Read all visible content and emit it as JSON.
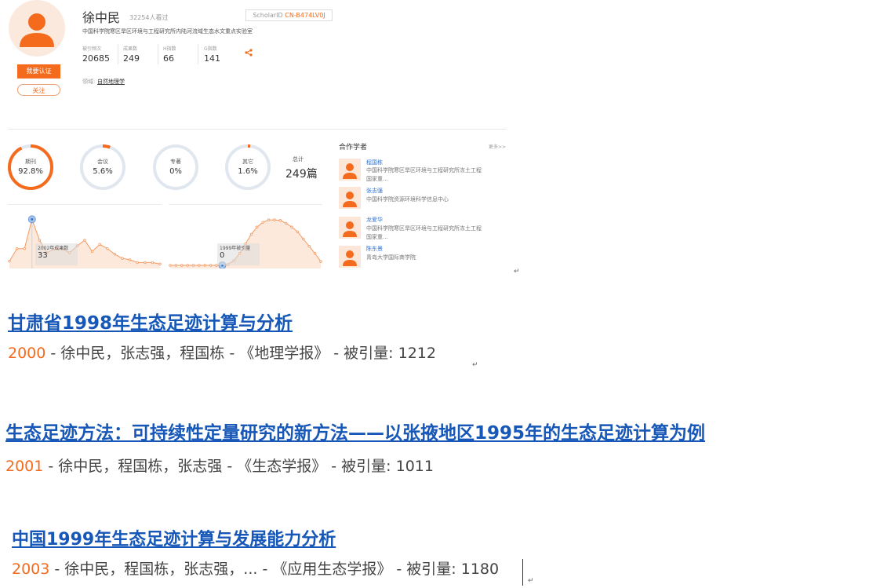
{
  "profile": {
    "name": "徐中民",
    "views": "32254人看过",
    "scholar_id_label": "ScholarID ",
    "scholar_id": "CN-B474LV0J",
    "affiliation": "中国科学院寒区旱区环境与工程研究所内陆河流域生态水文重点实验室",
    "verify_button": "我要认证",
    "follow_button": "关注",
    "stats": [
      {
        "label": "被引频次",
        "value": "20685"
      },
      {
        "label": "成果数",
        "value": "249"
      },
      {
        "label": "H指数",
        "value": "66"
      },
      {
        "label": "G指数",
        "value": "141"
      }
    ],
    "field_label": "领域:",
    "field_value": "自然地理学"
  },
  "pub_types": [
    {
      "label": "期刊",
      "value": "92.8%",
      "fraction": 0.928
    },
    {
      "label": "会议",
      "value": "5.6%",
      "fraction": 0.056
    },
    {
      "label": "专著",
      "value": "0%",
      "fraction": 0
    },
    {
      "label": "其它",
      "value": "1.6%",
      "fraction": 0.016
    }
  ],
  "total": {
    "label": "总计",
    "value": "249篇"
  },
  "coauthors": {
    "title": "合作学者",
    "more": "更多>>",
    "items": [
      {
        "name": "程国栋",
        "affiliation": "中国科学院寒区旱区环境与工程研究所冻土工程国家重..."
      },
      {
        "name": "张志强",
        "affiliation": "中国科学院资源环境科学信息中心"
      },
      {
        "name": "龙爱华",
        "affiliation": "中国科学院寒区旱区环境与工程研究所冻土工程国家重..."
      },
      {
        "name": "陈东景",
        "affiliation": "青岛大学国际商学院"
      }
    ]
  },
  "chart_data": [
    {
      "type": "area",
      "title": "",
      "tooltip_label": "2002年成果数",
      "tooltip_value": "33",
      "values": [
        3,
        12,
        12,
        33,
        18,
        9,
        12,
        12,
        9,
        14,
        18,
        10,
        15,
        12,
        8,
        5,
        4,
        2,
        2,
        2,
        1
      ],
      "highlight_index": 3,
      "ylim": [
        0,
        36
      ]
    },
    {
      "type": "area",
      "title": "",
      "tooltip_label": "1999年被引量",
      "tooltip_value": "0",
      "values": [
        0,
        0,
        0,
        0,
        0,
        0,
        0,
        0,
        0,
        0,
        2,
        10,
        25,
        45,
        65,
        80,
        90,
        95,
        95,
        94,
        88,
        80,
        70,
        55,
        40,
        25,
        8
      ],
      "highlight_index": 9,
      "ylim": [
        0,
        105
      ]
    }
  ],
  "papers": [
    {
      "title": "甘肃省1998年生态足迹计算与分析",
      "year": "2000",
      "authors": " - 徐中民，张志强，程国栋 - ",
      "journal": "《地理学报》",
      "cited": " - 被引量: 1212"
    },
    {
      "title": "生态足迹方法：可持续性定量研究的新方法——以张掖地区1995年的生态足迹计算为例",
      "year": "2001",
      "authors": " - 徐中民，程国栋，张志强 - ",
      "journal": "《生态学报》",
      "cited": " - 被引量: 1011"
    },
    {
      "title": "中国1999年生态足迹计算与发展能力分析",
      "year": "2003",
      "authors": " - 徐中民，程国栋，张志强，... - ",
      "journal": "《应用生态学报》",
      "cited": " - 被引量: 1180"
    }
  ],
  "return_mark": "↵",
  "colors": {
    "accent": "#f56b1e",
    "ring_track": "#e1e7ef",
    "link": "#1657b8",
    "area_fill": "#fce9dc"
  },
  "icons": {
    "avatar": "person-avatar-icon",
    "share": "share-icon"
  }
}
